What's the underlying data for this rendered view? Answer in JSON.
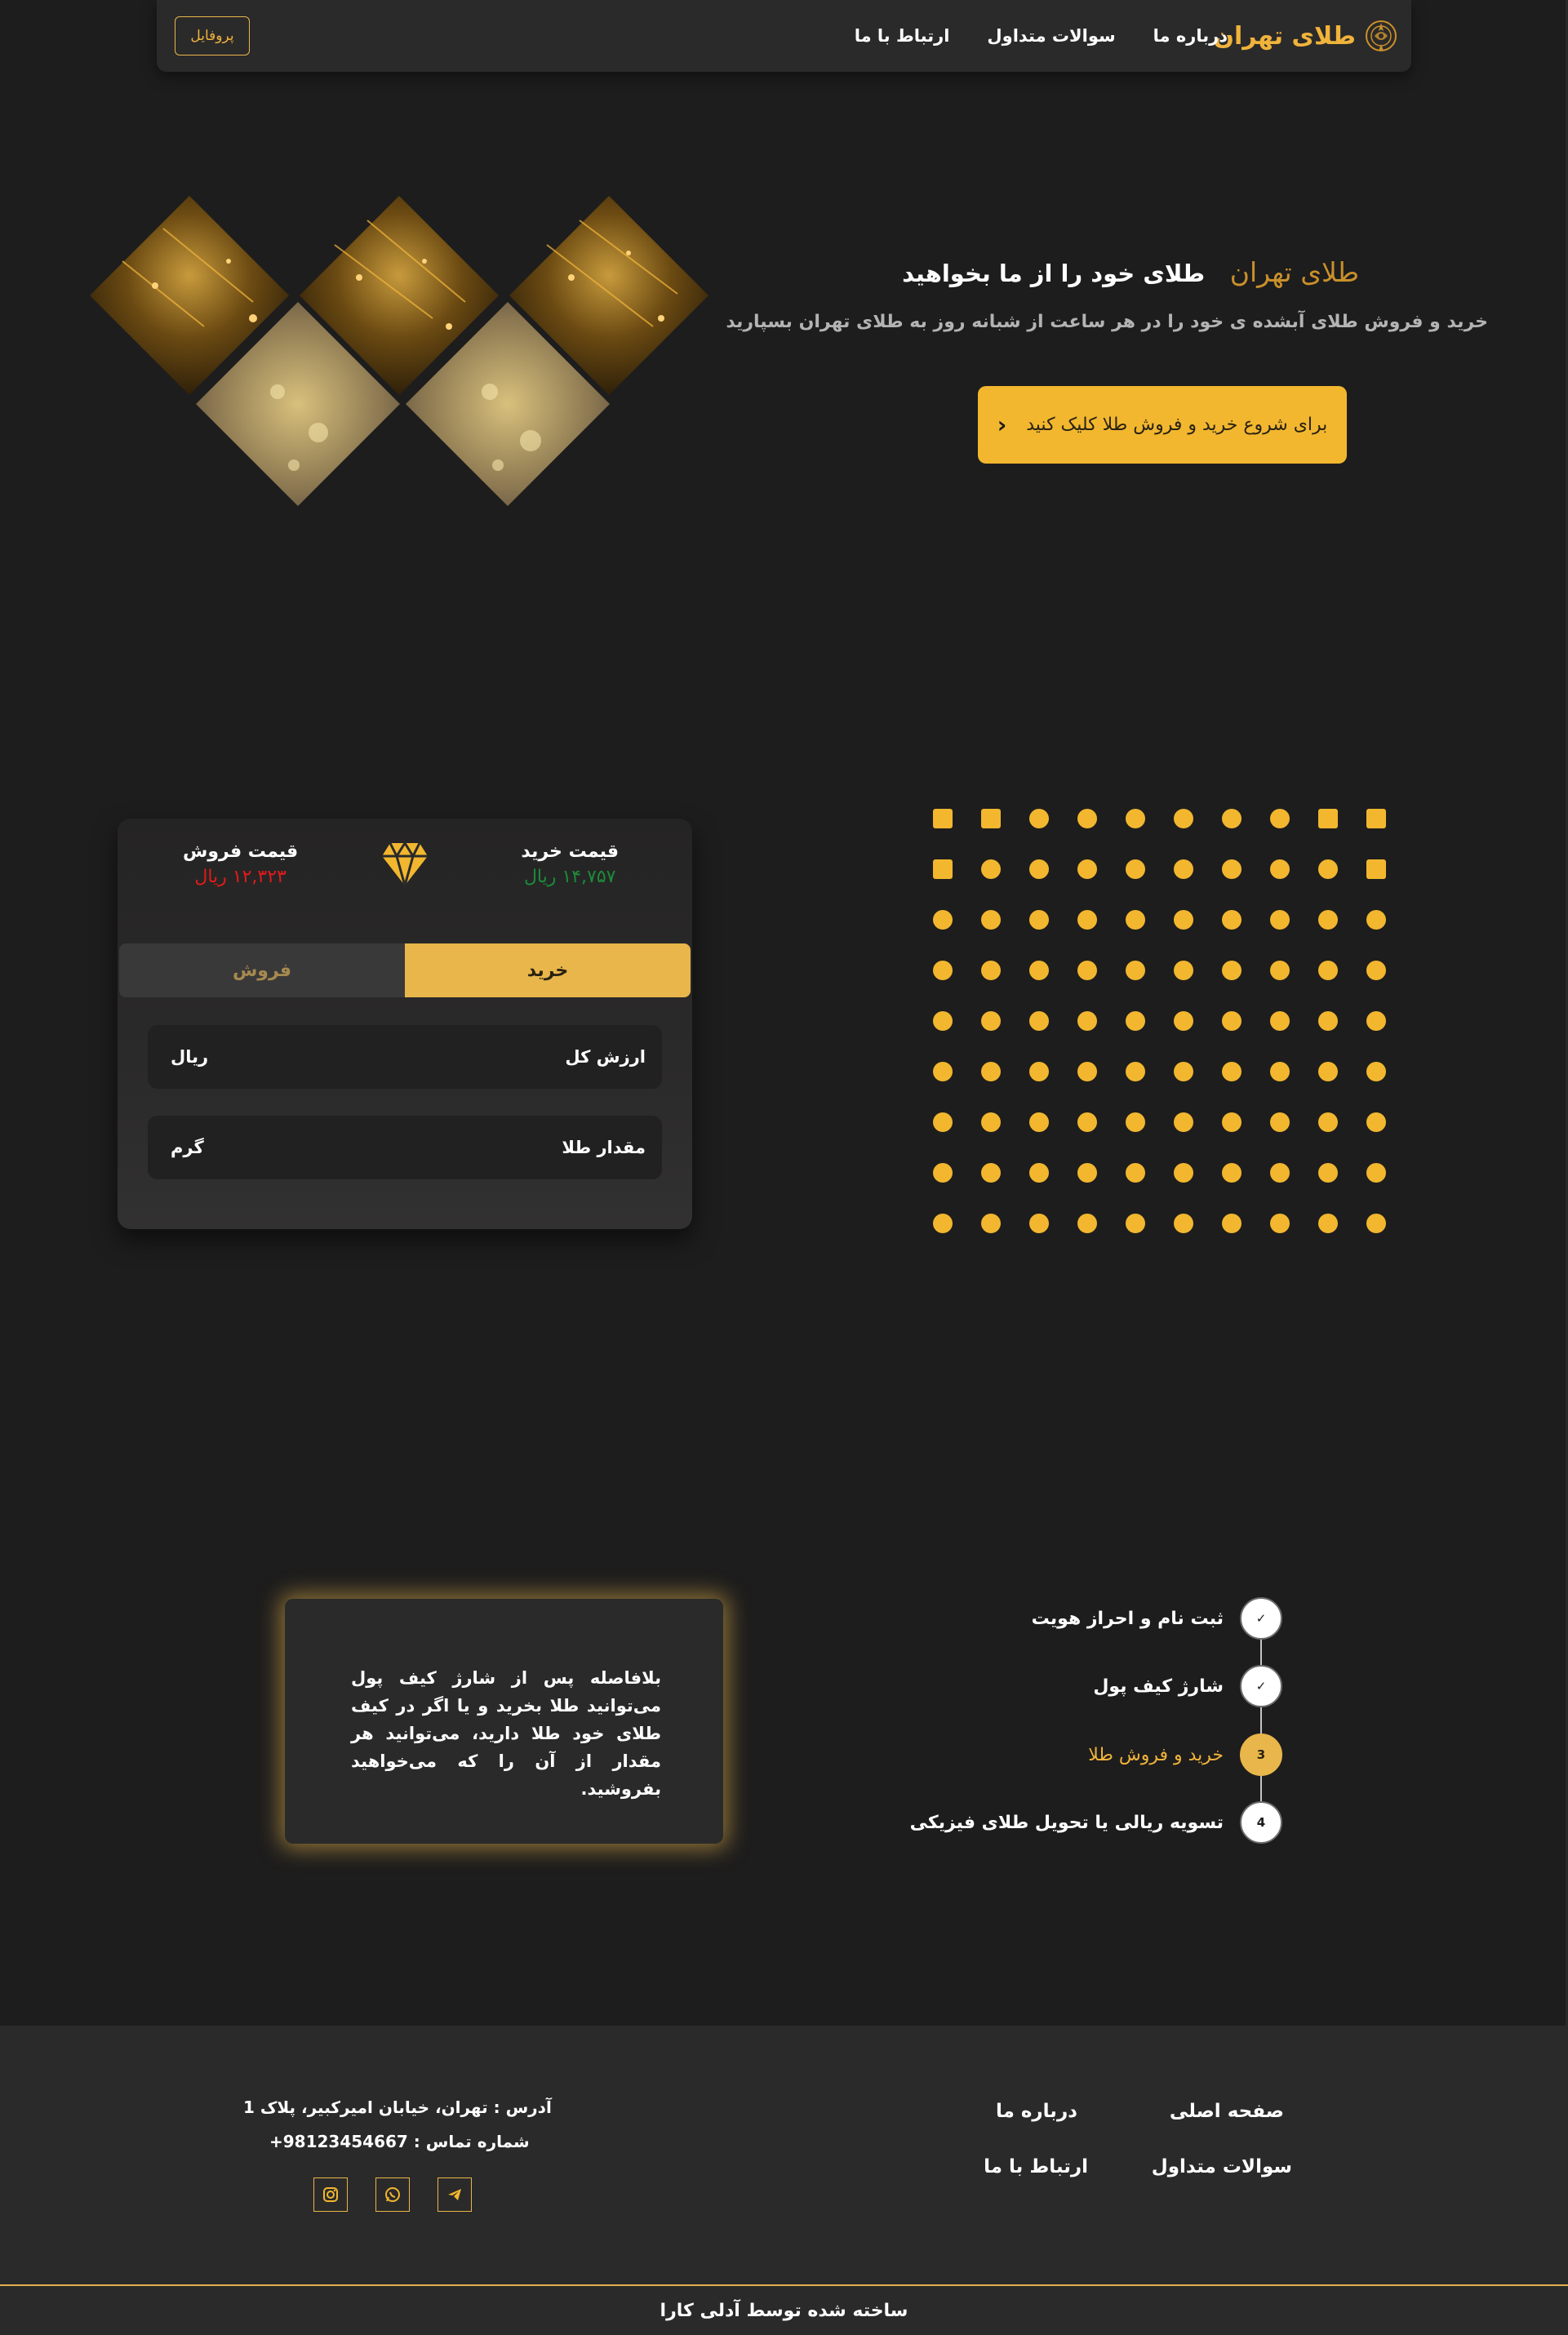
{
  "navbar": {
    "brand_name": "طلای تهران",
    "links": [
      "درباره ما",
      "سوالات متداول",
      "ارتباط با ما"
    ],
    "profile_label": "پروفایل"
  },
  "hero": {
    "title_gold": "طلای تهران",
    "title_white": "طلای خود را از ما بخواهید",
    "subtitle": "خرید و فروش طلای آبشده ی خود را در هر ساعت از شبانه روز به طلای تهران بسپارید",
    "cta_label": "برای شروع خرید و فروش طلا کلیک کنید"
  },
  "trade": {
    "buy_price_label": "قیمت خرید",
    "buy_price_value": "۱۴,۷۵۷ ریال",
    "sell_price_label": "قیمت فروش",
    "sell_price_value": "۱۲,۳۲۳ ریال",
    "tab_buy": "خرید",
    "tab_sell": "فروش",
    "field_total_label": "ارزش کل",
    "field_total_unit": "ریال",
    "field_amount_label": "مقدار طلا",
    "field_amount_unit": "گرم"
  },
  "steps": {
    "items": [
      {
        "label": "ثبت نام و احراز هویت",
        "marker": "✓"
      },
      {
        "label": "شارژ کیف پول",
        "marker": "✓"
      },
      {
        "label": "خرید و فروش طلا",
        "marker": "3"
      },
      {
        "label": "تسویه ریالی یا تحویل طلای فیزیکی",
        "marker": "4"
      }
    ],
    "active_index": 2,
    "info_text": "بلافاصله پس از شارژ کیف پول می‌توانید طلا بخرید و یا اگر در کیف طلای خود طلا دارید، می‌توانید هر مقدار از آن را که می‌خواهید بفروشید."
  },
  "footer": {
    "links": [
      "صفحه اصلی",
      "درباره ما",
      "سوالات متداول",
      "ارتباط با ما"
    ],
    "address": "آدرس : تهران، خیابان امیرکبیر، پلاک 1",
    "phone": "شماره تماس : 98123454667+",
    "socials": [
      "instagram-icon",
      "whatsapp-icon",
      "telegram-icon"
    ],
    "credit": "ساخته شده توسط آدلی کارا"
  },
  "colors": {
    "accent": "#f2b72f",
    "background": "#1e1d1d",
    "panel": "#2b2a2a",
    "buy_green": "#1b8c3a",
    "sell_red": "#e21b1b"
  }
}
